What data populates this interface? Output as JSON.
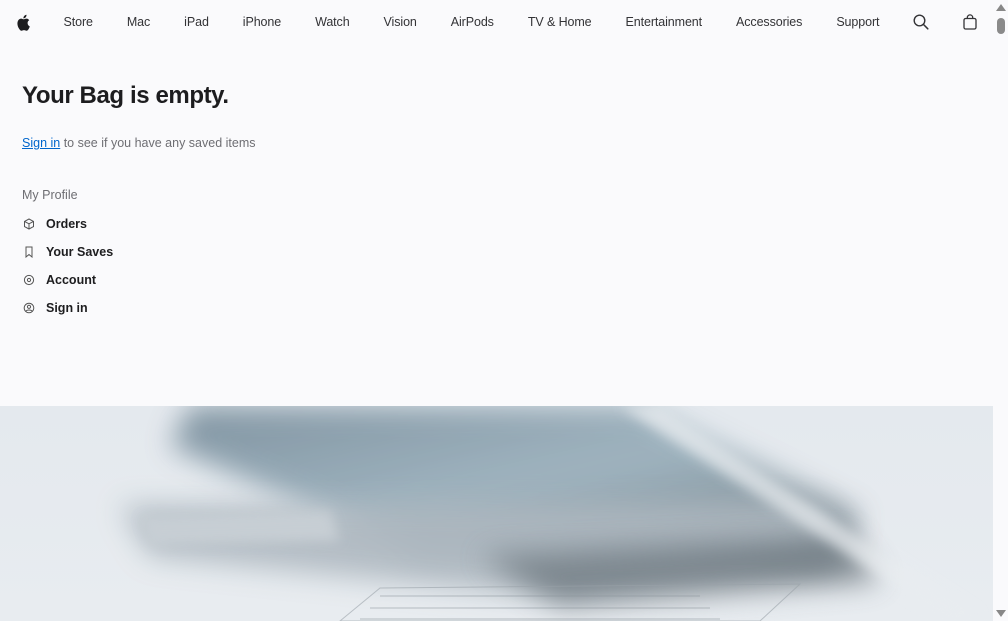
{
  "nav": {
    "items": [
      {
        "label": "Store"
      },
      {
        "label": "Mac"
      },
      {
        "label": "iPad"
      },
      {
        "label": "iPhone"
      },
      {
        "label": "Watch"
      },
      {
        "label": "Vision"
      },
      {
        "label": "AirPods"
      },
      {
        "label": "TV & Home"
      },
      {
        "label": "Entertainment"
      },
      {
        "label": "Accessories"
      },
      {
        "label": "Support"
      }
    ],
    "icons": {
      "logo": "apple-logo-icon",
      "search": "search-icon",
      "bag": "bag-icon"
    }
  },
  "bag": {
    "title": "Your Bag is empty.",
    "signin_link": "Sign in",
    "signin_suffix": " to see if you have any saved items"
  },
  "profile": {
    "heading": "My Profile",
    "items": [
      {
        "label": "Orders",
        "icon": "box-icon"
      },
      {
        "label": "Your Saves",
        "icon": "bookmark-icon"
      },
      {
        "label": "Account",
        "icon": "gear-icon"
      },
      {
        "label": "Sign in",
        "icon": "person-circle-icon"
      }
    ]
  },
  "colors": {
    "link": "#0066cc",
    "background": "#fafafc",
    "text": "#1d1d1f"
  }
}
